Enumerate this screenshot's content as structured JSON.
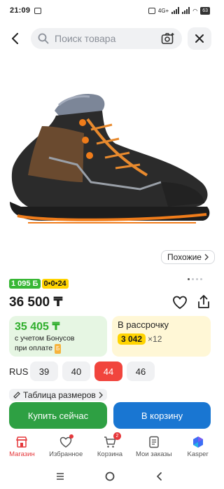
{
  "status_bar": {
    "time": "21:09",
    "network": "4G+",
    "battery": "63"
  },
  "search": {
    "placeholder": "Поиск товара"
  },
  "similar": {
    "label": "Похожие"
  },
  "badges": {
    "bonus": "1 095 Б",
    "installment": "0•0•24"
  },
  "price": {
    "main": "36 500 ₸"
  },
  "bonus_card": {
    "amount": "35 405 ₸",
    "line1": "с учетом Бонусов",
    "line2": "при оплате",
    "tiny_badge": "Б"
  },
  "installment_card": {
    "title": "В рассрочку",
    "monthly": "3 042",
    "times": "×12"
  },
  "sizes": {
    "label": "RUS",
    "options": [
      {
        "value": "39"
      },
      {
        "value": "40"
      },
      {
        "value": "44",
        "selected": true
      },
      {
        "value": "46"
      }
    ]
  },
  "size_table": {
    "label": "Таблица размеров"
  },
  "actions": {
    "buy_now": "Купить сейчас",
    "add_to_cart": "В корзину"
  },
  "tabbar": {
    "items": [
      {
        "label": "Магазин",
        "icon": "store-icon",
        "active": true
      },
      {
        "label": "Избранное",
        "icon": "heart-icon"
      },
      {
        "label": "Корзина",
        "icon": "cart-icon",
        "badge": "2"
      },
      {
        "label": "Мои заказы",
        "icon": "orders-icon"
      },
      {
        "label": "Kasper",
        "icon": "kasper-icon"
      }
    ]
  },
  "colors": {
    "accent_red": "#f1453d",
    "buy_green": "#2ea043",
    "cart_blue": "#1976d2",
    "bonus_green": "#38b735",
    "installment_yellow": "#ffd400"
  }
}
